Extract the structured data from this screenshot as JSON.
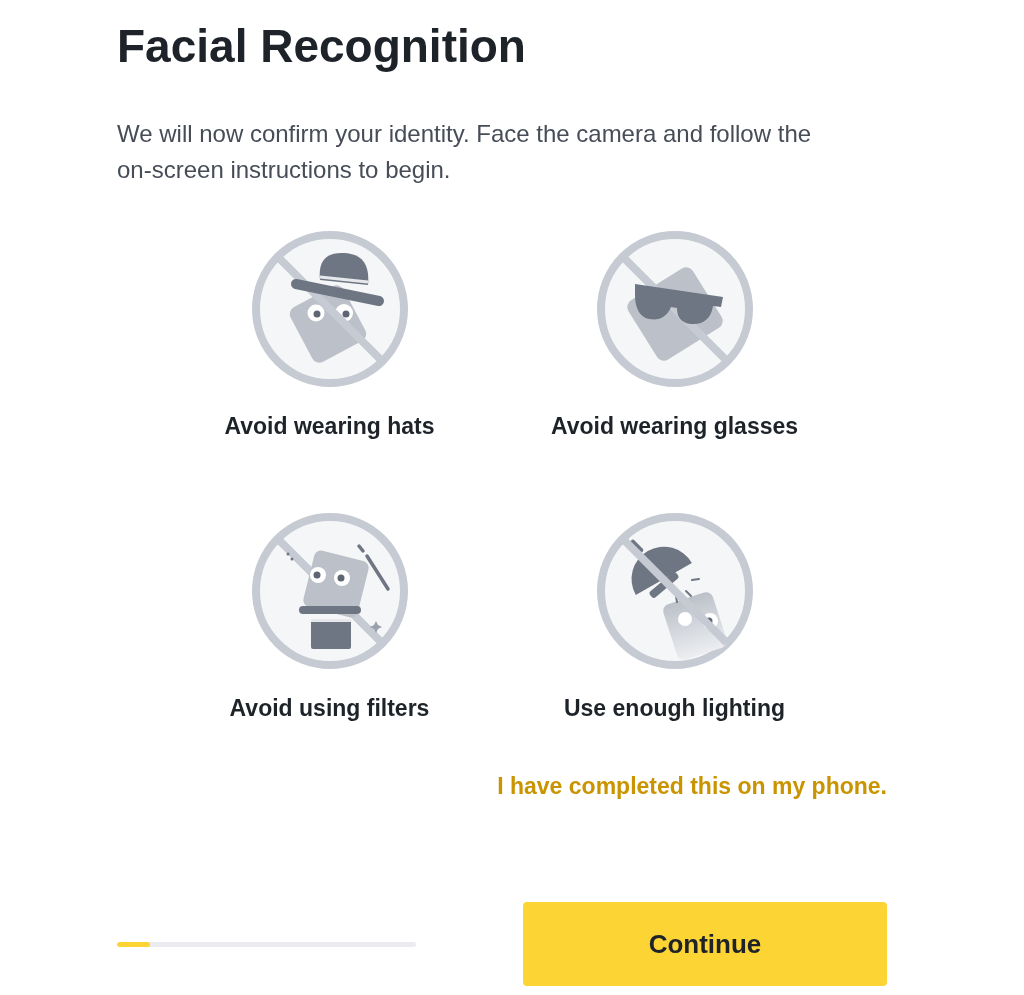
{
  "title": "Facial Recognition",
  "description": "We will now confirm your identity. Face the camera and follow the on-screen instructions to begin.",
  "tips": [
    {
      "kind": "hat",
      "label": "Avoid wearing hats"
    },
    {
      "kind": "glasses",
      "label": "Avoid wearing glasses"
    },
    {
      "kind": "filter",
      "label": "Avoid using filters"
    },
    {
      "kind": "lighting",
      "label": "Use enough lighting"
    }
  ],
  "phone_link": "I have completed this on my phone.",
  "progress": {
    "level": 0.11
  },
  "button": "Continue"
}
